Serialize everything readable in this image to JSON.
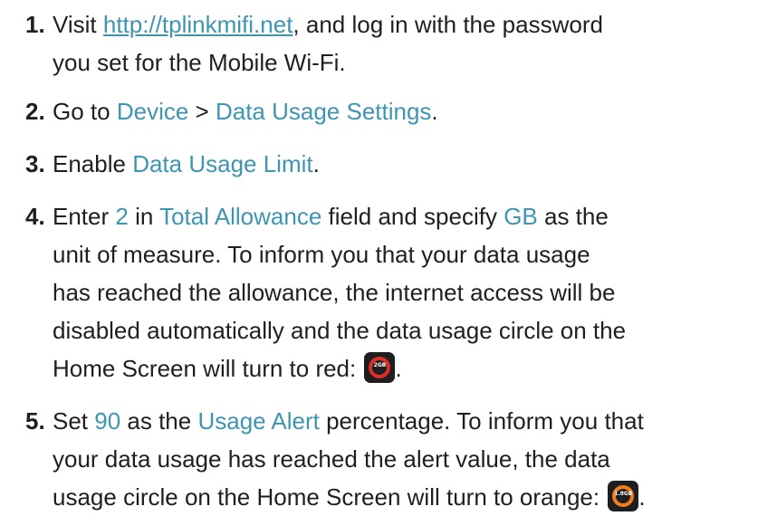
{
  "steps": [
    {
      "num": "1.",
      "line1_a": "Visit ",
      "link": "http://tplinkmifi.net",
      "line1_b": ", and log in with the password",
      "line2": "you set for the Mobile Wi-Fi."
    },
    {
      "num": "2.",
      "a": "Go to ",
      "device": "Device",
      "sep": " > ",
      "settings": "Data Usage Settings",
      "end": "."
    },
    {
      "num": "3.",
      "a": "Enable ",
      "limit": "Data Usage Limit",
      "end": "."
    },
    {
      "num": "4.",
      "a": "Enter ",
      "value": "2",
      "b": " in ",
      "field": "Total Allowance",
      "c": " field and specify ",
      "unit": "GB",
      "d": " as the",
      "line2": "unit of measure. To inform you that your data usage",
      "line3": "has reached the allowance, the internet access will be",
      "line4": "disabled automatically and the data usage circle on the",
      "line5": "Home Screen will turn to red:",
      "badge_text": "2GB",
      "end": "."
    },
    {
      "num": "5.",
      "a": "Set ",
      "value": "90",
      "b": " as the ",
      "alert": "Usage Alert",
      "c": " percentage. To inform you that",
      "line2": "your data usage has reached the alert value, the data",
      "line3": "usage circle on the Home Screen will turn to orange:",
      "badge_text": "1.8GB",
      "end": "."
    }
  ],
  "colors": {
    "highlight": "#3e95b1",
    "red": "#e02b2b",
    "orange": "#f07c20"
  }
}
